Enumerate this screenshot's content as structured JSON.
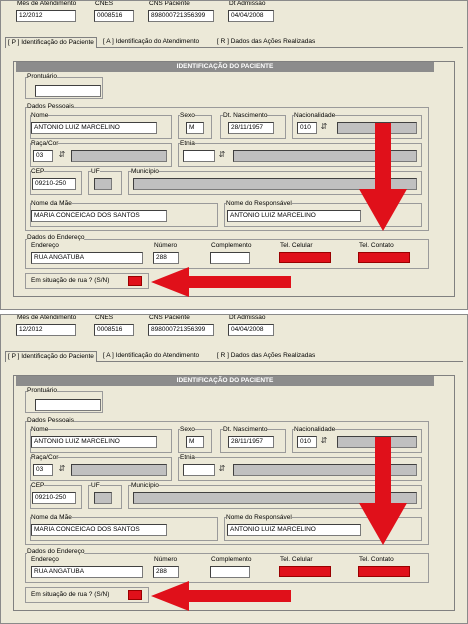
{
  "panels": [
    {
      "header": {
        "mes_label": "Mês de Atendimento",
        "mes_value": "12/2012",
        "cnes_label": "CNES",
        "cnes_value": "0008516",
        "cns_label": "CNS Paciente",
        "cns_value": "898000721356399",
        "adm_label": "Dt Admissão",
        "adm_value": "04/04/2008"
      },
      "tabs": [
        "[ P ] Identificação do Paciente",
        "[ A ] Identificação do Atendimento",
        "[ R ] Dados das Ações Realizadas"
      ],
      "section_title": "IDENTIFICAÇÃO DO PACIENTE",
      "prontuario_label": "Prontuário",
      "prontuario_value": "",
      "dados_pessoais_label": "Dados Pessoais",
      "nome_label": "Nome",
      "nome_value": "ANTONIO LUIZ MARCELINO",
      "sexo_label": "Sexo",
      "sexo_value": "M",
      "nasc_label": "Dt. Nascimento",
      "nasc_value": "28/11/1957",
      "nac_label": "Nacionalidade",
      "nac_value": "010",
      "raca_label": "Raça/Cor",
      "raca_value": "03",
      "etnia_label": "Etnia",
      "etnia_value": "",
      "cep_label": "CEP",
      "cep_value": "09210-250",
      "uf_label": "UF",
      "uf_value": "",
      "municipio_label": "Município",
      "municipio_value": "",
      "mae_label": "Nome da Mãe",
      "mae_value": "MARIA CONCEICAO DOS SANTOS",
      "resp_label": "Nome do Responsável",
      "resp_value": "ANTONIO LUIZ MARCELINO",
      "endereco_group_label": "Dados do Endereço",
      "endereco_label": "Endereço",
      "endereco_value": "RUA ANGATUBA",
      "numero_label": "Número",
      "numero_value": "288",
      "complemento_label": "Complemento",
      "complemento_value": "",
      "celular_label": "Tel. Celular",
      "contato_label": "Tel. Contato",
      "rua_label": "Em situação de rua ? (S/N)"
    },
    {
      "header": {
        "mes_label": "Mês de Atendimento",
        "mes_value": "12/2012",
        "cnes_label": "CNES",
        "cnes_value": "0008516",
        "cns_label": "CNS Paciente",
        "cns_value": "898000721356399",
        "adm_label": "Dt Admissão",
        "adm_value": "04/04/2008"
      },
      "tabs": [
        "[ P ] Identificação do Paciente",
        "[ A ] Identificação do Atendimento",
        "[ R ] Dados das Ações Realizadas"
      ],
      "section_title": "IDENTIFICAÇÃO DO PACIENTE",
      "prontuario_label": "Prontuário",
      "prontuario_value": "",
      "dados_pessoais_label": "Dados Pessoais",
      "nome_label": "Nome",
      "nome_value": "ANTONIO LUIZ MARCELINO",
      "sexo_label": "Sexo",
      "sexo_value": "M",
      "nasc_label": "Dt. Nascimento",
      "nasc_value": "28/11/1957",
      "nac_label": "Nacionalidade",
      "nac_value": "010",
      "raca_label": "Raça/Cor",
      "raca_value": "03",
      "etnia_label": "Etnia",
      "etnia_value": "",
      "cep_label": "CEP",
      "cep_value": "09210-250",
      "uf_label": "UF",
      "uf_value": "",
      "municipio_label": "Município",
      "municipio_value": "",
      "mae_label": "Nome da Mãe",
      "mae_value": "MARIA CONCEICAO DOS SANTOS",
      "resp_label": "Nome do Responsável",
      "resp_value": "ANTONIO LUIZ MARCELINO",
      "endereco_group_label": "Dados do Endereço",
      "endereco_label": "Endereço",
      "endereco_value": "RUA ANGATUBA",
      "numero_label": "Número",
      "numero_value": "288",
      "complemento_label": "Complemento",
      "complemento_value": "",
      "celular_label": "Tel. Celular",
      "contato_label": "Tel. Contato",
      "rua_label": "Em situação de rua ? (S/N)"
    }
  ],
  "colors": {
    "highlight_red": "#e0101a",
    "panel_bg": "#ece9d8",
    "title_bar": "#8c8c8c"
  },
  "icons": {
    "lookup": "lookup-icon",
    "arrow": "red-arrow-annotation"
  }
}
